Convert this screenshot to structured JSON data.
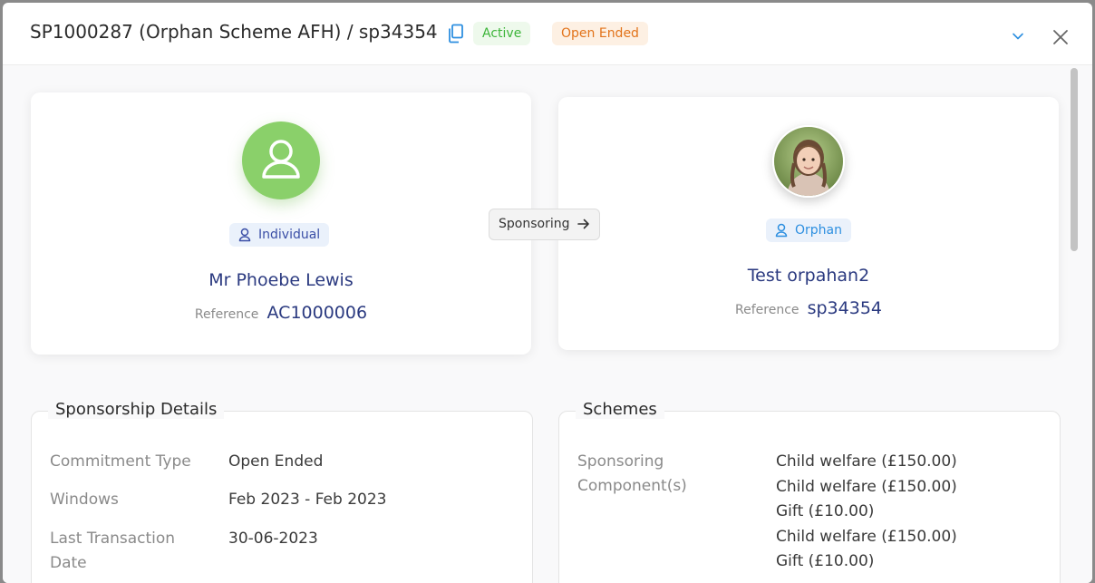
{
  "header": {
    "title": "SP1000287 (Orphan Scheme AFH) / sp34354",
    "status_badge": "Active",
    "commitment_badge": "Open Ended"
  },
  "sponsor": {
    "type": "Individual",
    "name": "Mr Phoebe Lewis",
    "reference_label": "Reference",
    "reference": "AC1000006"
  },
  "relation": {
    "label": "Sponsoring"
  },
  "beneficiary": {
    "type": "Orphan",
    "name": "Test orpahan2",
    "reference_label": "Reference",
    "reference": "sp34354"
  },
  "details": {
    "title": "Sponsorship Details",
    "rows": [
      {
        "label": "Commitment Type",
        "value": "Open Ended"
      },
      {
        "label": "Windows",
        "value": "Feb 2023 - Feb 2023"
      },
      {
        "label": "Last Transaction Date",
        "value": "30-06-2023"
      }
    ]
  },
  "schemes": {
    "title": "Schemes",
    "label": "Sponsoring Component(s)",
    "components": [
      "Child welfare (£150.00)",
      "Child welfare (£150.00)",
      "Gift (£10.00)",
      "Child welfare (£150.00)",
      "Gift (£10.00)"
    ]
  },
  "colors": {
    "active_badge_bg": "#eef9ec",
    "active_badge_text": "#3db53a",
    "open_badge_bg": "#fdf0e3",
    "open_badge_text": "#e2731a",
    "avatar_green": "#8ad06a",
    "name_blue": "#2b3a80",
    "copy_icon_blue": "#2d8fe0"
  },
  "icons": [
    "copy-icon",
    "chevron-down-icon",
    "close-icon",
    "user-icon",
    "arrow-right-icon"
  ]
}
